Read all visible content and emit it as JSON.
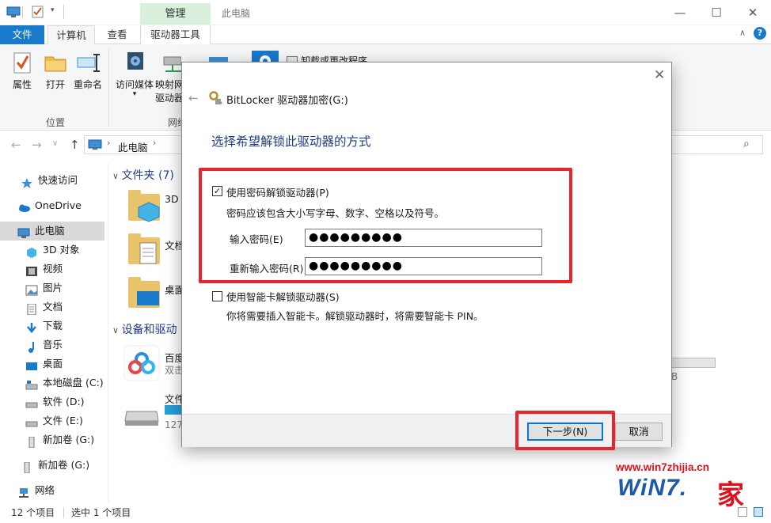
{
  "titlebar": {
    "manage_tab": "管理",
    "window_title": "此电脑",
    "minimize": "—",
    "maximize": "☐",
    "close": "✕"
  },
  "ribbon_tabs": {
    "file": "文件",
    "computer": "计算机",
    "view": "查看",
    "drive_tools": "驱动器工具"
  },
  "ribbon": {
    "properties": "属性",
    "open": "打开",
    "rename": "重命名",
    "access_media": "访问媒体",
    "map_drive_line1": "映射网",
    "map_drive_line2": "驱动器",
    "uninstall": "卸载或更改程序",
    "group_location": "位置",
    "group_network": "网络"
  },
  "address": {
    "path": "此电脑",
    "search_icon": "⌕"
  },
  "nav": {
    "items": [
      {
        "label": "快速访问"
      },
      {
        "label": "OneDrive"
      },
      {
        "label": "此电脑"
      },
      {
        "label": "3D 对象"
      },
      {
        "label": "视频"
      },
      {
        "label": "图片"
      },
      {
        "label": "文档"
      },
      {
        "label": "下载"
      },
      {
        "label": "音乐"
      },
      {
        "label": "桌面"
      },
      {
        "label": "本地磁盘 (C:)"
      },
      {
        "label": "软件 (D:)"
      },
      {
        "label": "文件 (E:)"
      },
      {
        "label": "新加卷 (G:)"
      },
      {
        "label": "新加卷 (G:)"
      },
      {
        "label": "网络"
      }
    ]
  },
  "content": {
    "folders_header": "文件夹 (7)",
    "folder_3d": "3D",
    "folder_docs": "文档",
    "folder_desktop": "桌面",
    "devices_header": "设备和驱动",
    "baidu_line1": "百度",
    "baidu_line2": "双击",
    "drive_name": "文件",
    "drive_size": "127",
    "right_fragment": "B"
  },
  "status": {
    "count": "12 个项目",
    "selected": "选中 1 个项目"
  },
  "dialog": {
    "title": "BitLocker 驱动器加密(G:)",
    "heading": "选择希望解锁此驱动器的方式",
    "password_option": "使用密码解锁驱动器(P)",
    "password_checked": true,
    "password_hint": "密码应该包含大小写字母、数字、空格以及符号。",
    "enter_password_label": "输入密码(E)",
    "enter_password_value": "●●●●●●●●●",
    "reenter_password_label": "重新输入密码(R)",
    "reenter_password_value": "●●●●●●●●●",
    "smartcard_option": "使用智能卡解锁驱动器(S)",
    "smartcard_checked": false,
    "smartcard_hint": "你将需要插入智能卡。解锁驱动器时，将需要智能卡 PIN。",
    "next_button": "下一步(N)",
    "cancel_button": "取消",
    "close_glyph": "✕",
    "back_glyph": "←",
    "check_glyph": "✓"
  },
  "watermark": {
    "url": "www.win7zhijia.cn",
    "logo": "WiN7.",
    "home": "家"
  },
  "colors": {
    "accent": "#1979ca",
    "highlight_box": "#e8242e",
    "heading": "#1e3c87"
  }
}
